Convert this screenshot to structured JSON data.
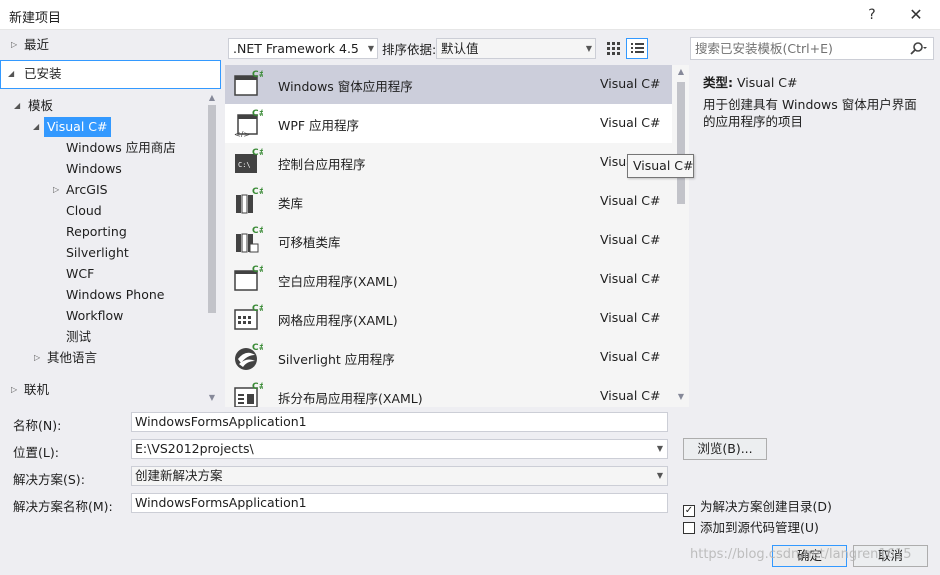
{
  "window": {
    "title": "新建项目",
    "help": "?",
    "close": "✕"
  },
  "tree": {
    "recent": "最近",
    "installed": "已安装",
    "templates": "模板",
    "visual_csharp": "Visual C#",
    "children": [
      "Windows 应用商店",
      "Windows",
      "ArcGIS",
      "Cloud",
      "Reporting",
      "Silverlight",
      "WCF",
      "Windows Phone",
      "Workflow",
      "测试"
    ],
    "other_languages": "其他语言",
    "online": "联机"
  },
  "toolbar": {
    "framework": ".NET Framework 4.5",
    "sort_label": "排序依据:",
    "sort_value": "默认值"
  },
  "templates": [
    {
      "name": "Windows 窗体应用程序",
      "lang": "Visual C#",
      "icon": "winforms-icon"
    },
    {
      "name": "WPF 应用程序",
      "lang": "Visual C#",
      "icon": "wpf-icon"
    },
    {
      "name": "控制台应用程序",
      "lang": "Visual C#",
      "icon": "console-icon"
    },
    {
      "name": "类库",
      "lang": "Visual C#",
      "icon": "class-library-icon"
    },
    {
      "name": "可移植类库",
      "lang": "Visual C#",
      "icon": "portable-library-icon"
    },
    {
      "name": "空白应用程序(XAML)",
      "lang": "Visual C#",
      "icon": "blank-app-icon"
    },
    {
      "name": "网格应用程序(XAML)",
      "lang": "Visual C#",
      "icon": "grid-app-icon"
    },
    {
      "name": "Silverlight 应用程序",
      "lang": "Visual C#",
      "icon": "silverlight-icon"
    },
    {
      "name": "拆分布局应用程序(XAML)",
      "lang": "Visual C#",
      "icon": "split-app-icon"
    }
  ],
  "tooltip": "Visual C#",
  "search": {
    "placeholder": "搜索已安装模板(Ctrl+E)"
  },
  "description": {
    "type_label": "类型:",
    "type_value": "Visual C#",
    "text": "用于创建具有 Windows 窗体用户界面的应用程序的项目"
  },
  "form": {
    "name_label": "名称(N):",
    "name_value": "WindowsFormsApplication1",
    "location_label": "位置(L):",
    "location_value": "E:\\VS2012projects\\",
    "solution_label": "解决方案(S):",
    "solution_value": "创建新解决方案",
    "solution_name_label": "解决方案名称(M):",
    "solution_name_value": "WindowsFormsApplication1",
    "browse": "浏览(B)...",
    "create_dir": "为解决方案创建目录(D)",
    "add_source": "添加到源代码管理(U)",
    "ok": "确定",
    "cancel": "取消"
  },
  "watermark": "https://blog.csdn.net/langren1615",
  "colors": {
    "accent": "#3399ff",
    "selected_row": "#cccedb",
    "csharp_green": "#388a34"
  }
}
